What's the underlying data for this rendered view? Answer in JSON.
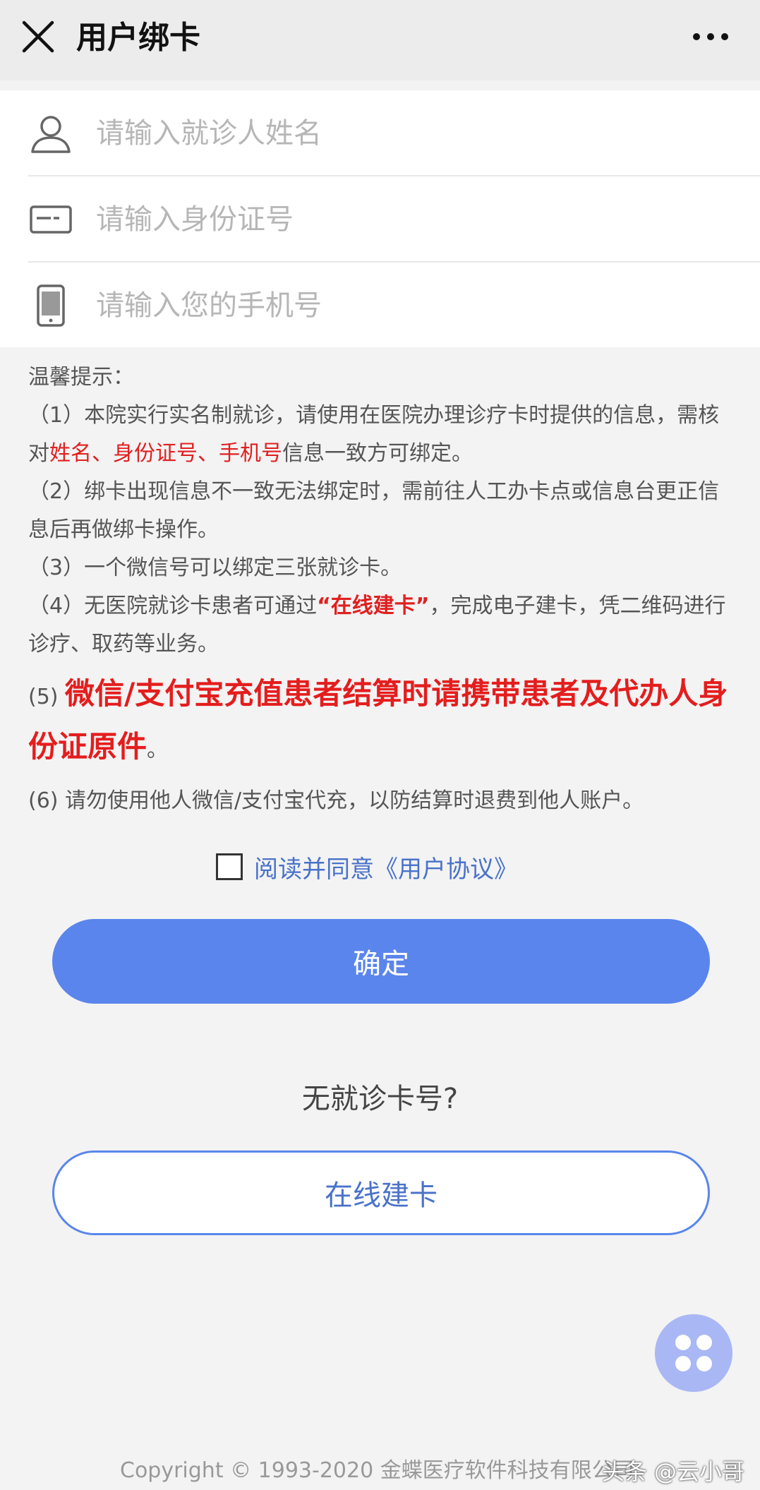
{
  "header": {
    "title": "用户绑卡"
  },
  "form": {
    "name_placeholder": "请输入就诊人姓名",
    "id_placeholder": "请输入身份证号",
    "phone_placeholder": "请输入您的手机号"
  },
  "tips": {
    "heading": "温馨提示：",
    "item1_a": "（1）本院实行实名制就诊，请使用在医院办理诊疗卡时提供的信息，需核对",
    "item1_red": "姓名、身份证号、手机号",
    "item1_b": "信息一致方可绑定。",
    "item2": "（2）绑卡出现信息不一致无法绑定时，需前往人工办卡点或信息台更正信息后再做绑卡操作。",
    "item3": "（3）一个微信号可以绑定三张就诊卡。",
    "item4_a": "（4）无医院就诊卡患者可通过",
    "item4_red": "“在线建卡”",
    "item4_b": "，完成电子建卡，凭二维码进行诊疗、取药等业务。",
    "item5_num": "(5)",
    "item5_red": "微信/支付宝充值患者结算时请携带患者及代办人身份证原件",
    "item5_end": "。",
    "item6": "(6) 请勿使用他人微信/支付宝代充，以防结算时退费到他人账户。"
  },
  "agreement": {
    "label": "阅读并同意《用户协议》",
    "checked": false
  },
  "buttons": {
    "confirm": "确定",
    "no_card": "无就诊卡号?",
    "online_card": "在线建卡"
  },
  "footer": {
    "copyright": "Copyright © 1993-2020 金蝶医疗软件科技有限公司",
    "watermark": "头条 @云小哥"
  },
  "colors": {
    "primary": "#5a85ec",
    "link": "#4a72c9",
    "warning": "#e02020",
    "float_button": "#a9b8f4"
  },
  "icons": [
    "close-icon",
    "more-icon",
    "user-icon",
    "id-card-icon",
    "phone-icon",
    "grid-icon"
  ]
}
